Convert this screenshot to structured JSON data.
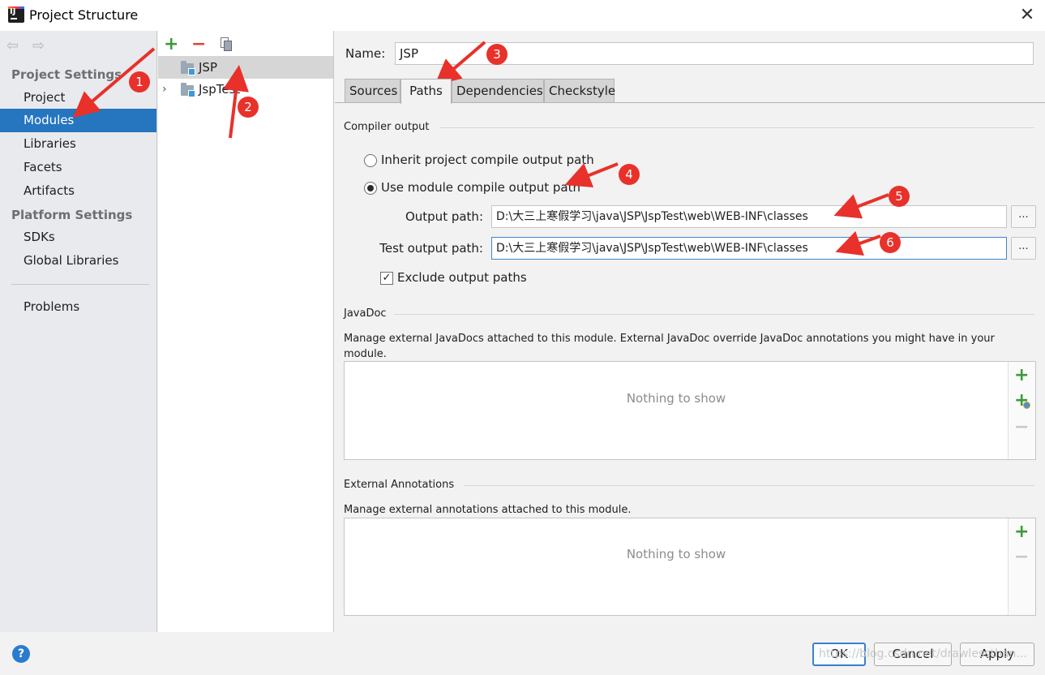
{
  "window": {
    "title": "Project Structure",
    "close_glyph": "✕"
  },
  "sidebar": {
    "nav_back": "⇦",
    "nav_forward": "⇨",
    "project_settings_header": "Project Settings",
    "platform_settings_header": "Platform Settings",
    "items": [
      {
        "label": "Project"
      },
      {
        "label": "Modules",
        "selected": true
      },
      {
        "label": "Libraries"
      },
      {
        "label": "Facets"
      },
      {
        "label": "Artifacts"
      },
      {
        "label": "SDKs"
      },
      {
        "label": "Global Libraries"
      },
      {
        "label": "Problems"
      }
    ]
  },
  "tree": {
    "tool_add": "+",
    "tool_remove": "−",
    "modules": [
      {
        "label": "JSP",
        "selected": true
      },
      {
        "label": "JspTest",
        "expandable": true,
        "chevron": "›"
      }
    ]
  },
  "module": {
    "name_label": "Name:",
    "name_value": "JSP",
    "tabs": [
      "Sources",
      "Paths",
      "Dependencies",
      "Checkstyle"
    ],
    "active_tab": "Paths"
  },
  "compiler_output": {
    "title": "Compiler output",
    "option_inherit": "Inherit project compile output path",
    "option_module": "Use module compile output path",
    "selected_option": "module",
    "output_path_label": "Output path:",
    "output_path_value": "D:\\大三上寒假学习\\java\\JSP\\JspTest\\web\\WEB-INF\\classes",
    "test_output_path_label": "Test output path:",
    "test_output_path_value": "D:\\大三上寒假学习\\java\\JSP\\JspTest\\web\\WEB-INF\\classes",
    "browse_label": "...",
    "exclude_label": "Exclude output paths",
    "exclude_checked": true,
    "check_glyph": "✓"
  },
  "javadoc": {
    "title": "JavaDoc",
    "description_line1": "Manage external JavaDocs attached to this module. External JavaDoc override JavaDoc annotations you might have in your",
    "description_line2": "module.",
    "empty_text": "Nothing to show",
    "add_glyph": "+",
    "remove_glyph": "−"
  },
  "external_annotations": {
    "title": "External Annotations",
    "description": "Manage external annotations attached to this module.",
    "empty_text": "Nothing to show",
    "add_glyph": "+",
    "remove_glyph": "−"
  },
  "buttons": {
    "help": "?",
    "ok": "OK",
    "cancel": "Cancel",
    "apply": "Apply"
  },
  "watermark": "https://blog.csdn.net/drawlessthan...",
  "annotation_badges": [
    "1",
    "2",
    "3",
    "4",
    "5",
    "6"
  ],
  "colors": {
    "selection": "#2675bf",
    "annotation": "#e8312a",
    "add": "#3a9b3a",
    "remove": "#d9463d"
  }
}
